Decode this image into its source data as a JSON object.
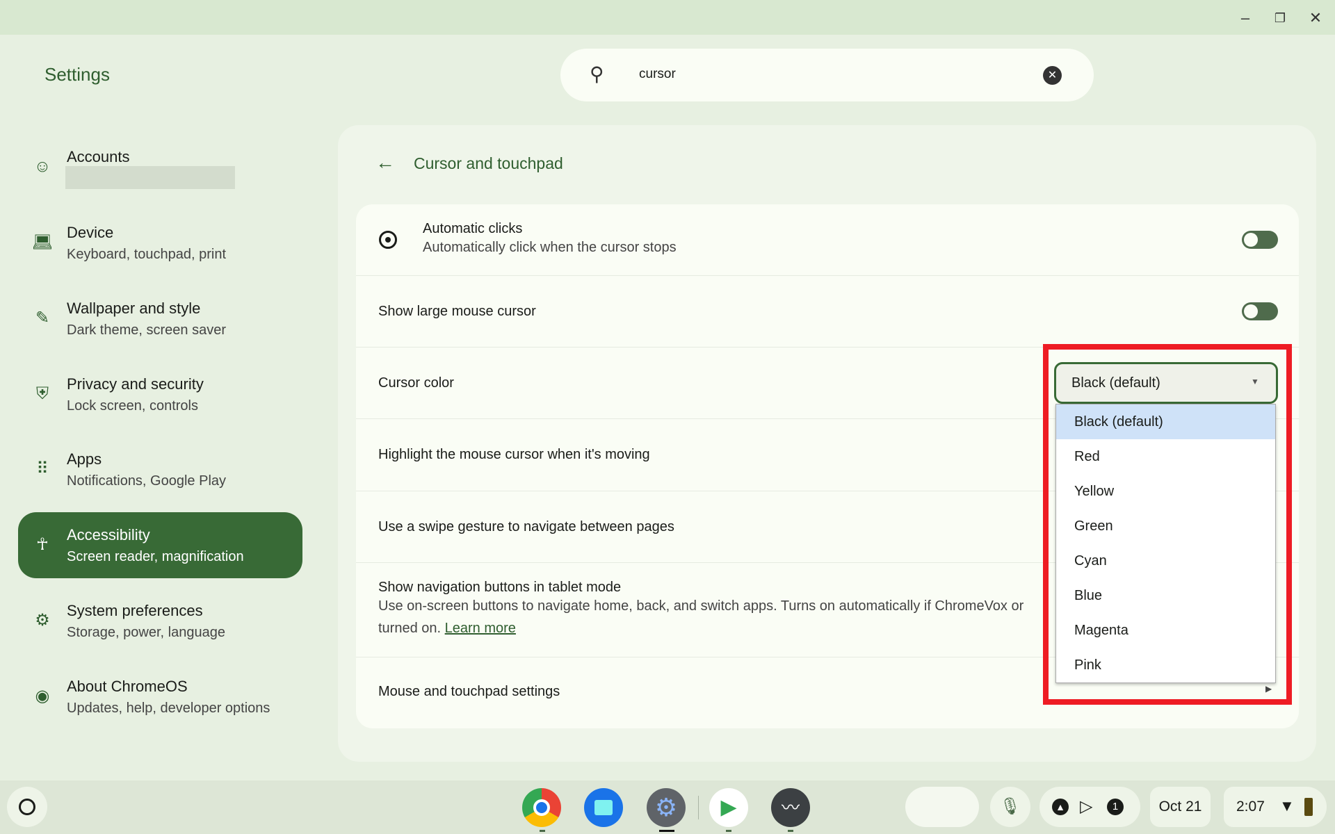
{
  "window": {
    "minimize_icon": "minimize-icon",
    "restore_icon": "restore-icon",
    "close_icon": "close-icon"
  },
  "app_title": "Settings",
  "search": {
    "value": "cursor",
    "icon": "search-icon",
    "clear_icon": "clear-icon"
  },
  "sidebar": {
    "items": [
      {
        "label": "Accounts",
        "sub": "",
        "icon": "face-icon"
      },
      {
        "label": "Device",
        "sub": "Keyboard, touchpad, print",
        "icon": "laptop-icon"
      },
      {
        "label": "Wallpaper and style",
        "sub": "Dark theme, screen saver",
        "icon": "palette-icon"
      },
      {
        "label": "Privacy and security",
        "sub": "Lock screen, controls",
        "icon": "shield-icon"
      },
      {
        "label": "Apps",
        "sub": "Notifications, Google Play",
        "icon": "apps-grid-icon"
      },
      {
        "label": "Accessibility",
        "sub": "Screen reader, magnification",
        "icon": "accessibility-icon",
        "active": true
      },
      {
        "label": "System preferences",
        "sub": "Storage, power, language",
        "icon": "gear-icon"
      },
      {
        "label": "About ChromeOS",
        "sub": "Updates, help, developer options",
        "icon": "chromeos-icon"
      }
    ]
  },
  "page": {
    "title": "Cursor and touchpad",
    "rows": {
      "auto_clicks": {
        "label": "Automatic clicks",
        "sub": "Automatically click when the cursor stops",
        "on": false
      },
      "large_cursor": {
        "label": "Show large mouse cursor",
        "on": false
      },
      "cursor_color": {
        "label": "Cursor color",
        "value": "Black (default)"
      },
      "highlight": {
        "label": "Highlight the mouse cursor when it's moving"
      },
      "swipe": {
        "label": "Use a swipe gesture to navigate between pages"
      },
      "nav_buttons": {
        "label": "Show navigation buttons in tablet mode",
        "sub": "Use on-screen buttons to navigate home, back, and switch apps. Turns on automatically if ChromeVox or",
        "sub2": "turned on.",
        "link": "Learn more"
      },
      "mouse": {
        "label": "Mouse and touchpad settings"
      }
    }
  },
  "dropdown": {
    "options": [
      "Black (default)",
      "Red",
      "Yellow",
      "Green",
      "Cyan",
      "Blue",
      "Magenta",
      "Pink"
    ],
    "selected": "Black (default)"
  },
  "highlight_color": "#ee1c24",
  "accent_color": "#386a36",
  "taskbar": {
    "apps": [
      "Chrome",
      "Files",
      "Settings",
      "Play Store",
      "Diagnostics"
    ],
    "date": "Oct 21",
    "time": "2:07",
    "notification_count": "1"
  }
}
